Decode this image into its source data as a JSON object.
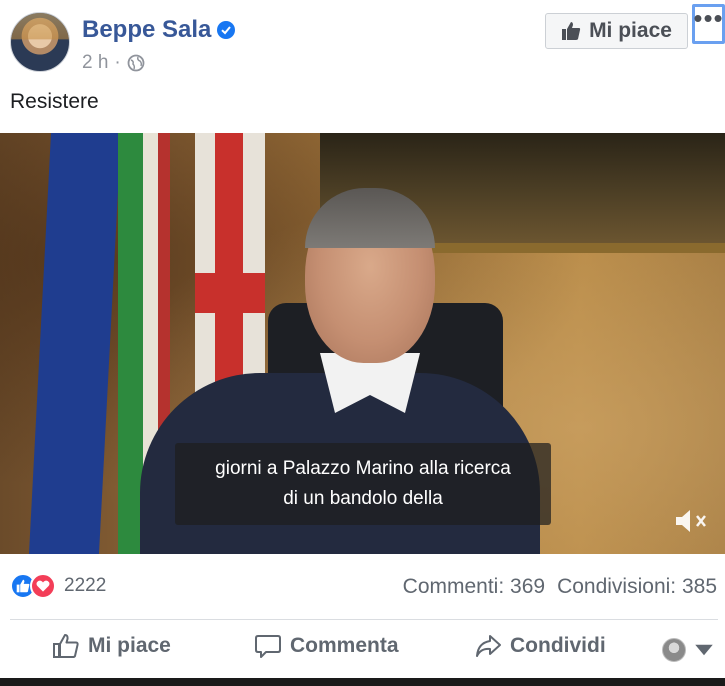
{
  "post": {
    "author": "Beppe Sala",
    "time": "2 h",
    "separator": "·",
    "text": "Resistere"
  },
  "header": {
    "like_page_label": "Mi piace",
    "more_label": "•••"
  },
  "video": {
    "subtitle_line1": "giorni a Palazzo Marino alla ricerca",
    "subtitle_line2": "di un bandolo della"
  },
  "stats": {
    "reaction_count": "2222",
    "comments": "Commenti: 369",
    "shares": "Condivisioni: 385"
  },
  "actions": {
    "like": "Mi piace",
    "comment": "Commenta",
    "share": "Condividi"
  },
  "colors": {
    "name": "#385898",
    "verified": "#1877f2",
    "like_reaction": "#1877f2",
    "love_reaction": "#f33e58",
    "muted_text": "#606770",
    "focus_outline": "#6aa0f0"
  }
}
